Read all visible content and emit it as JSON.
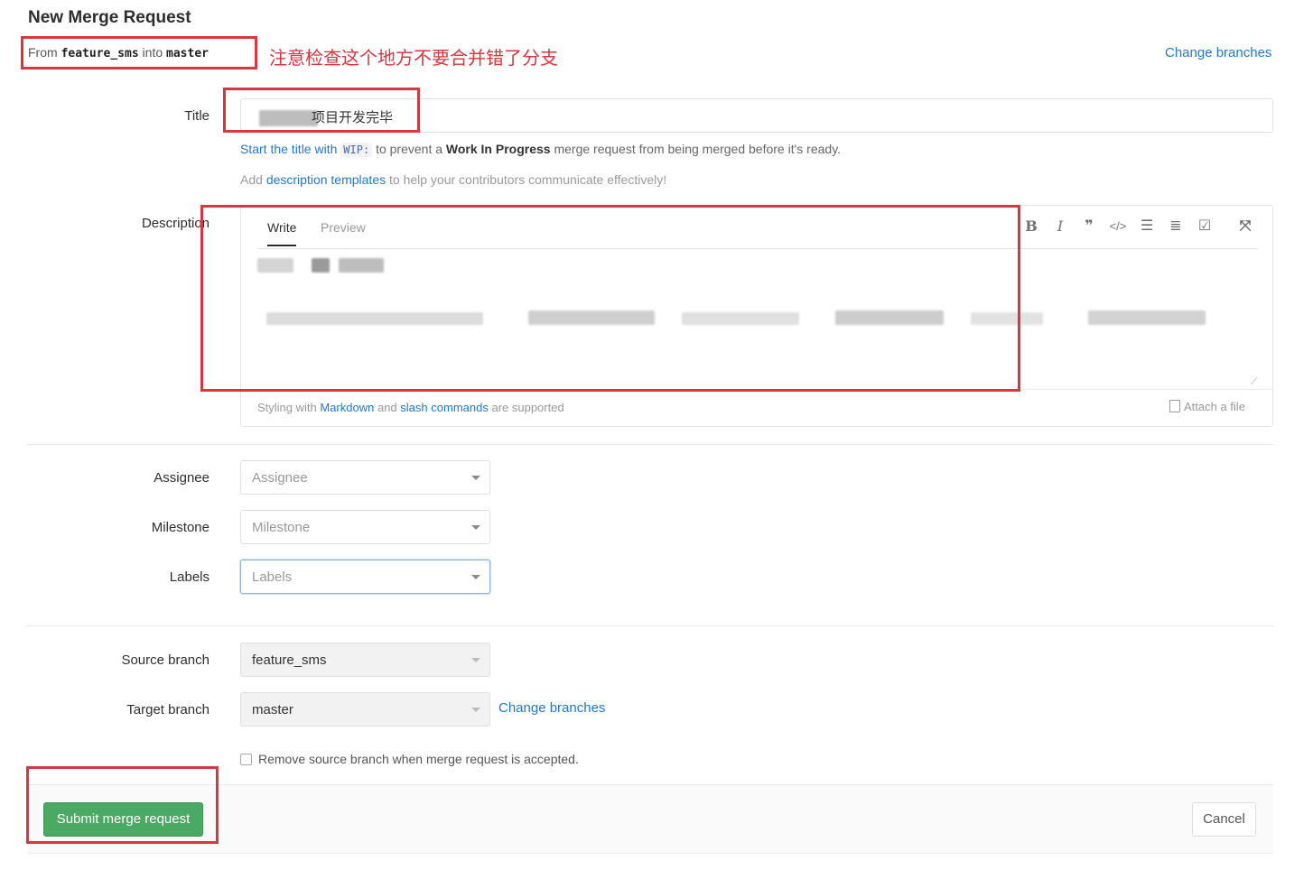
{
  "page": {
    "title": "New Merge Request",
    "annotation": "注意检查这个地方不要合并错了分支"
  },
  "branch_summary": {
    "from_label": "From",
    "source": "feature_sms",
    "into_label": "into",
    "target": "master",
    "change_link": "Change branches"
  },
  "title_field": {
    "label": "Title",
    "value": "项目开发完毕"
  },
  "hints": {
    "wip_prefix": "Start the title with",
    "wip_code": "WIP:",
    "wip_middle": "to prevent a",
    "wip_bold": "Work In Progress",
    "wip_suffix": "merge request from being merged before it's ready.",
    "templates_prefix": "Add",
    "templates_link": "description templates",
    "templates_suffix": "to help your contributors communicate effectively!"
  },
  "description": {
    "label": "Description",
    "tab_write": "Write",
    "tab_preview": "Preview",
    "toolbar": [
      "bold-icon",
      "italic-icon",
      "quote-icon",
      "code-icon",
      "bullet-list-icon",
      "numbered-list-icon",
      "task-list-icon",
      "fullscreen-icon"
    ],
    "footer_prefix": "Styling with",
    "footer_markdown": "Markdown",
    "footer_and": "and",
    "footer_slash": "slash commands",
    "footer_suffix": "are supported",
    "attach": "Attach a file"
  },
  "assignee": {
    "label": "Assignee",
    "placeholder": "Assignee"
  },
  "milestone": {
    "label": "Milestone",
    "placeholder": "Milestone"
  },
  "labels": {
    "label": "Labels",
    "placeholder": "Labels"
  },
  "source_branch": {
    "label": "Source branch",
    "value": "feature_sms"
  },
  "target_branch": {
    "label": "Target branch",
    "value": "master",
    "change_link": "Change branches"
  },
  "remove_branch": {
    "label": "Remove source branch when merge request is accepted.",
    "checked": false
  },
  "actions": {
    "submit": "Submit merge request",
    "cancel": "Cancel"
  },
  "colors": {
    "annotation_red": "#d9363e",
    "submit_green": "#4aa963",
    "link_blue": "#1f78d1"
  }
}
